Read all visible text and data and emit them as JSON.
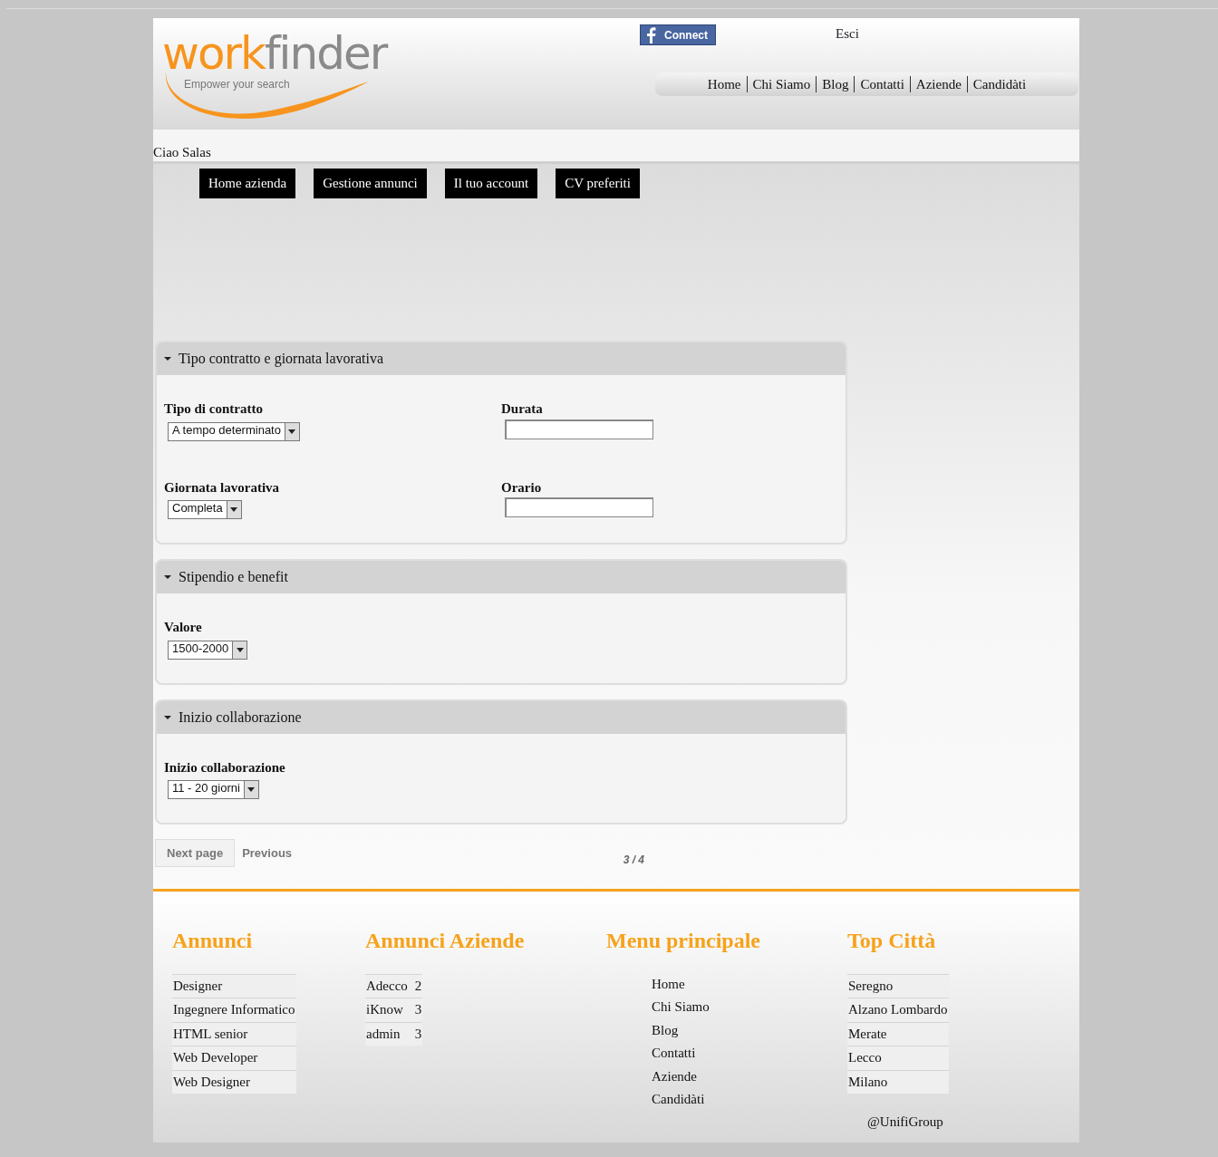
{
  "header": {
    "logo": {
      "word_1": "work",
      "word_2": "finder",
      "tagline": "Empower your search"
    },
    "facebook_button": {
      "label": "Connect"
    },
    "logout_link": "Esci",
    "top_nav": [
      "Home",
      "Chi Siamo",
      "Blog",
      "Contatti",
      "Aziende",
      "Candidàti"
    ]
  },
  "greeting": "Ciao Salas",
  "account_menu": [
    "Home azienda",
    "Gestione annunci",
    "Il tuo account",
    "CV preferiti"
  ],
  "sections": [
    {
      "title": "Tipo contratto e giornata lavorativa",
      "expanded": true,
      "fields": [
        {
          "label": "Tipo di contratto",
          "kind": "select",
          "value": "A tempo determinato"
        },
        {
          "label": "Durata",
          "kind": "text"
        },
        {
          "label": "Giornata lavorativa",
          "kind": "select",
          "value": "Completa"
        },
        {
          "label": "Orario",
          "kind": "text"
        }
      ]
    },
    {
      "title": "Stipendio e benefit",
      "expanded": true,
      "fields": [
        {
          "label": "Valore",
          "kind": "select",
          "value": "1500-2000"
        }
      ]
    },
    {
      "title": "Inizio collaborazione",
      "expanded": true,
      "fields": [
        {
          "label": "Inizio collaborazione",
          "kind": "select",
          "value": "11 - 20 giorni"
        }
      ]
    }
  ],
  "pager": {
    "next": "Next page",
    "previous": "Previous",
    "page": "3 / 4"
  },
  "footer": {
    "columns": [
      {
        "title": "Annunci",
        "kind": "list",
        "items": [
          {
            "name": "Designer"
          },
          {
            "name": "Ingegnere Informatico"
          },
          {
            "name": "HTML senior"
          },
          {
            "name": "Web Developer"
          },
          {
            "name": "Web Designer"
          }
        ]
      },
      {
        "title": "Annunci Aziende",
        "kind": "counts",
        "items": [
          {
            "name": "Adecco",
            "count": "2"
          },
          {
            "name": "iKnow",
            "count": "3"
          },
          {
            "name": "admin",
            "count": "3"
          }
        ]
      },
      {
        "title": "Menu principale",
        "kind": "menu",
        "items": [
          {
            "name": "Home"
          },
          {
            "name": "Chi Siamo"
          },
          {
            "name": "Blog"
          },
          {
            "name": "Contatti"
          },
          {
            "name": "Aziende"
          },
          {
            "name": "Candidàti"
          }
        ]
      },
      {
        "title": "Top Città",
        "kind": "list",
        "items": [
          {
            "name": "Seregno"
          },
          {
            "name": "Alzano Lombardo"
          },
          {
            "name": "Merate"
          },
          {
            "name": "Lecco"
          },
          {
            "name": "Milano"
          }
        ]
      }
    ],
    "credit": "@UnifiGroup"
  }
}
